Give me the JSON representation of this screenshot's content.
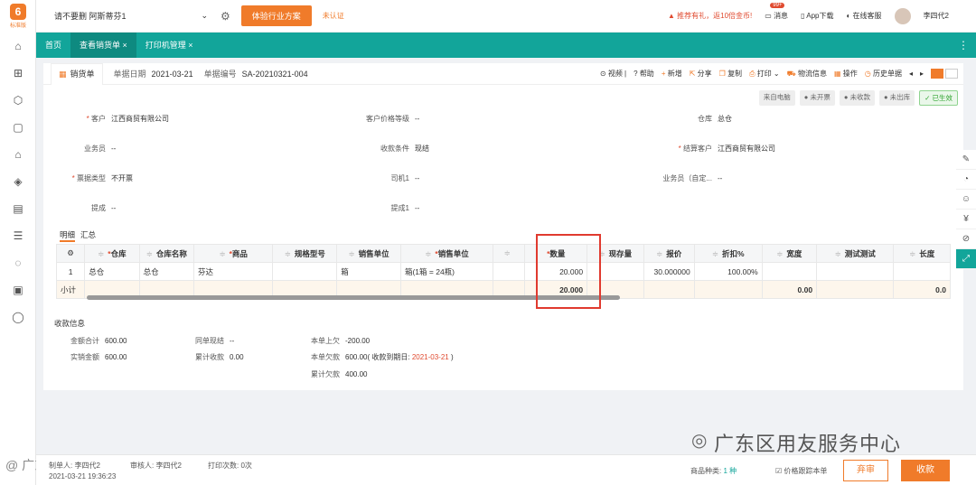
{
  "logo": {
    "mark": "6",
    "text": "标准版"
  },
  "sidebar_icons": [
    "home-icon",
    "gift-icon",
    "box-icon",
    "bag-icon",
    "warehouse-icon",
    "money-icon",
    "document-icon",
    "report-icon",
    "loop-icon",
    "book-icon",
    "chat-icon"
  ],
  "topbar": {
    "company": "请不要删 阿斯蒂芬1",
    "company_caret": "⌄",
    "upgrade": "体验行业方案",
    "uncertified": "未认证",
    "promo": "推荐有礼，返10倍金币!",
    "messages": "消息",
    "msg_badge": "99+",
    "app_download": "App下载",
    "support": "在线客服",
    "user": "李四代2"
  },
  "tabs": [
    {
      "label": "首页"
    },
    {
      "label": "查看销货单 ×"
    },
    {
      "label": "打印机管理 ×"
    }
  ],
  "doc": {
    "title": "销货单",
    "date_label": "单据日期",
    "date": "2021-03-21",
    "no_label": "单据编号",
    "no": "SA-20210321-004"
  },
  "toolbar": [
    "视频",
    "帮助",
    "新增",
    "分享",
    "复制",
    "打印",
    "物流信息",
    "操作",
    "历史单据"
  ],
  "status_chips": [
    "来自电脑",
    "未开票",
    "未收款",
    "未出库",
    "已生效"
  ],
  "form": {
    "customer_label": "客户",
    "customer": "江西商贸有限公司",
    "price_level_label": "客户价格等级",
    "price_level": "--",
    "warehouse_label": "仓库",
    "warehouse": "总仓",
    "salesman_label": "业务员",
    "salesman": "--",
    "pay_terms_label": "收款条件",
    "pay_terms": "现结",
    "settle_label": "结算客户",
    "settle": "江西商贸有限公司",
    "invoice_type_label": "票据类型",
    "invoice_type": "不开票",
    "driver_label": "司机1",
    "driver": "--",
    "salesman_custom_label": "业务员（自定...",
    "salesman_custom": "--",
    "bonus_label": "提成",
    "bonus": "--",
    "bonus1_label": "提成1",
    "bonus1": "--"
  },
  "sub_tabs": [
    "明细",
    "汇总"
  ],
  "grid": {
    "headers": [
      "仓库",
      "仓库名称",
      "商品",
      "规格型号",
      "销售单位",
      "销售单位",
      "",
      "数量",
      "现存量",
      "报价",
      "折扣%",
      "宽度",
      "测试测试",
      "长度"
    ],
    "row": {
      "idx": "1",
      "warehouse": "总仓",
      "wh_name": "总仓",
      "product": "芬达",
      "spec": "",
      "unit": "箱",
      "unit2": "箱(1箱 = 24瓶)",
      "qty": "20.000",
      "stock": "",
      "price": "30.000000",
      "discount": "100.00%",
      "width": "",
      "test": "",
      "length": ""
    },
    "subtotal": {
      "label": "小计",
      "qty": "20.000",
      "width": "0.00",
      "length": "0.0"
    }
  },
  "summary": {
    "title": "收款信息",
    "total_label": "金额合计",
    "total": "600.00",
    "paid_label": "实销金额",
    "paid": "600.00",
    "settle_label": "同单现结",
    "settle": "--",
    "cum_recv_label": "累计收款",
    "cum_recv": "0.00",
    "prev_owe_label": "本单上欠",
    "prev_owe": "-200.00",
    "owe_label": "本单欠款",
    "owe": "600.00",
    "owe_note_pre": "( 收款到期日: ",
    "owe_date": "2021-03-21",
    "owe_note_post": " )",
    "cum_owe_label": "累计欠款",
    "cum_owe": "400.00"
  },
  "right_icons": [
    "note-icon",
    "ear-icon",
    "face-icon",
    "fee-icon",
    "attach-icon",
    "expand-icon"
  ],
  "footer": {
    "maker": "制单人: 李四代2",
    "auditor": "审核人: 李四代2",
    "print_count": "打印次数: 0次",
    "timestamp": "2021-03-21 19:36:23",
    "kinds_label": "商品种类:",
    "kinds": "1 种",
    "price_track": "价格跟踪本单",
    "reject": "弃审",
    "collect": "收款"
  },
  "watermark": "广东区用友服务中心",
  "left_watermark": "@ 广东区域"
}
